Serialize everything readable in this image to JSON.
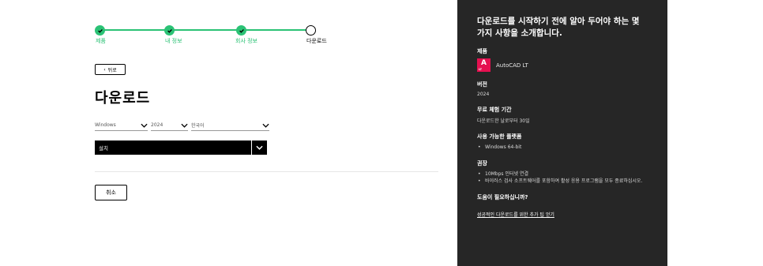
{
  "stepper": {
    "steps": [
      {
        "label": "제품",
        "state": "done"
      },
      {
        "label": "내 정보",
        "state": "done"
      },
      {
        "label": "회사 정보",
        "state": "done"
      },
      {
        "label": "다운로드",
        "state": "current"
      }
    ],
    "accent_color": "#2bc275"
  },
  "back_button": {
    "arrow": "‹",
    "label": "뒤로"
  },
  "title": "다운로드",
  "selects": {
    "os": "Windows",
    "version": "2024",
    "language": "한국어"
  },
  "install_select": {
    "label": "설치"
  },
  "cancel_button": "취소",
  "panel": {
    "heading": "다운로드를 시작하기 전에 알아 두어야 하는 몇 가지 사항을 소개합니다.",
    "product_title": "제품",
    "product_logo_letter": "A",
    "product_logo_sub": "LT",
    "product_name": "AutoCAD LT",
    "version_title": "버전",
    "version_value": "2024",
    "trial_title": "무료 체험 기간",
    "trial_value": "다운로드한 날로부터 30일",
    "platform_title": "사용 가능한 플랫폼",
    "platforms": [
      "Windows 64-bit"
    ],
    "recommend_title": "권장",
    "recommendations": [
      "10Mbps 인터넷 연결",
      "바이러스 검사 소프트웨어를 포함하여 활성 응용 프로그램을 모두 종료하십시오."
    ],
    "help_title": "도움이 필요하십니까?",
    "help_link": "성공적인 다운로드를 위한 추가 팁 얻기",
    "bg_color": "#262626"
  }
}
